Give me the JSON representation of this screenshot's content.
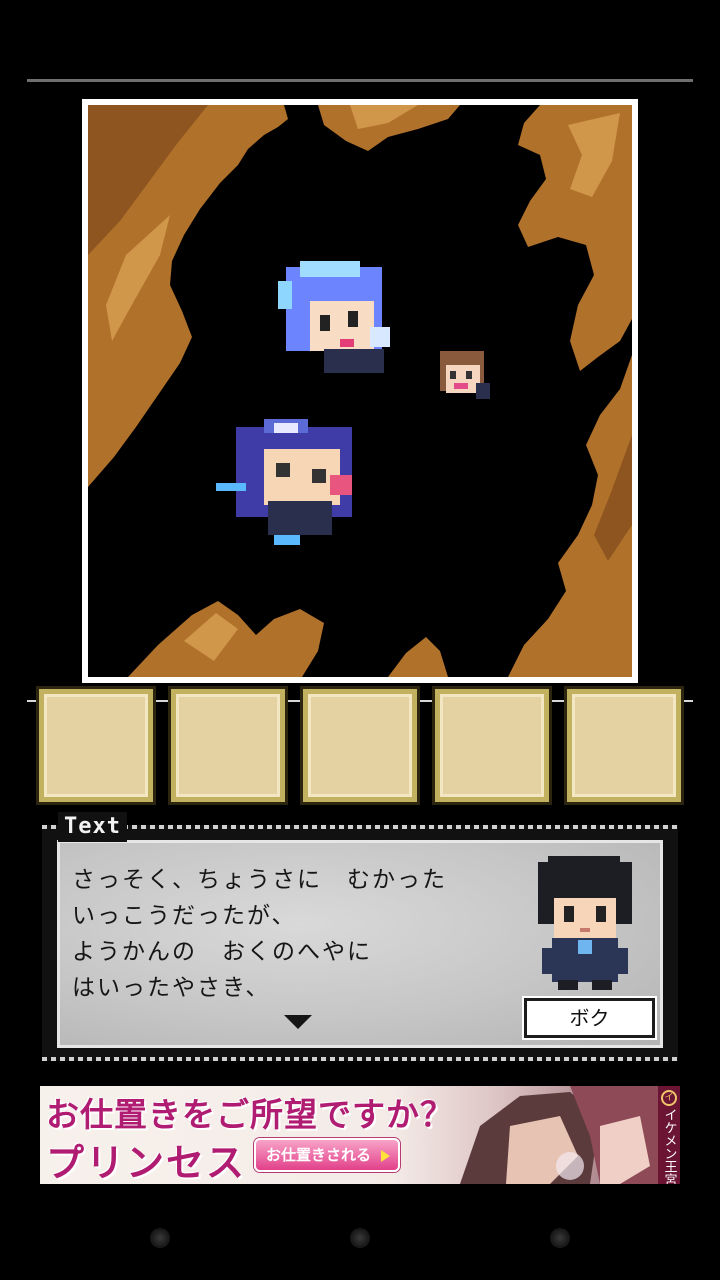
{
  "message_box": {
    "tab_label": "Text",
    "lines": [
      "さっそく、ちょうさに　むかった",
      "いっこうだったが、",
      "ようかんの　おくのへやに",
      "はいったやさき、"
    ],
    "speaker_name": "ボク"
  },
  "item_slots": {
    "count": 5
  },
  "ad": {
    "headline": "お仕置きをご所望ですか？",
    "title": "プリンセス",
    "button_label": "お仕置きされる",
    "brand": "イケメン王宮",
    "brand_mark": "イ"
  },
  "colors": {
    "cave_rock": "#b0712a",
    "slot_fill": "#e4d2a2",
    "slot_border": "#c2b15e",
    "ad_pink": "#b01c72"
  },
  "icons": {
    "next": "triangle-down-icon",
    "navigation": [
      "back-icon",
      "home-icon",
      "recent-apps-icon"
    ]
  }
}
